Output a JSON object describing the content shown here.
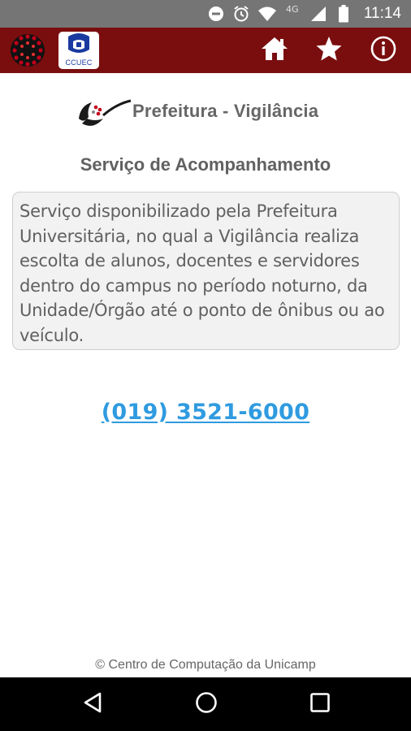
{
  "status_bar": {
    "time": "11:14",
    "network": "4G",
    "icons": [
      "do-not-disturb-icon",
      "alarm-icon",
      "wifi-icon",
      "cell-signal-icon",
      "battery-icon"
    ]
  },
  "app_bar": {
    "logos": [
      "unicamp-logo",
      "ccuec-logo"
    ],
    "ccuec_label": "CCUEC",
    "actions": [
      "home-icon",
      "star-icon",
      "info-icon"
    ],
    "color": "#7a0e0e"
  },
  "header": {
    "title": "Prefeitura - Vigilância"
  },
  "main": {
    "section_title": "Serviço de Acompanhamento",
    "description": "Serviço disponibilizado pela Prefeitura Universitária, no qual a Vigilância realiza escolta de alunos, docentes e servidores dentro do campus no período noturno, da Unidade/Órgão até o ponto de ônibus ou ao veículo.",
    "phone": "(019) 3521-6000",
    "link_color": "#2f9be0"
  },
  "footer": {
    "text": "© Centro de Computação da Unicamp"
  },
  "nav_bar": {
    "buttons": [
      "back-icon",
      "home-circle-icon",
      "recents-icon"
    ]
  }
}
